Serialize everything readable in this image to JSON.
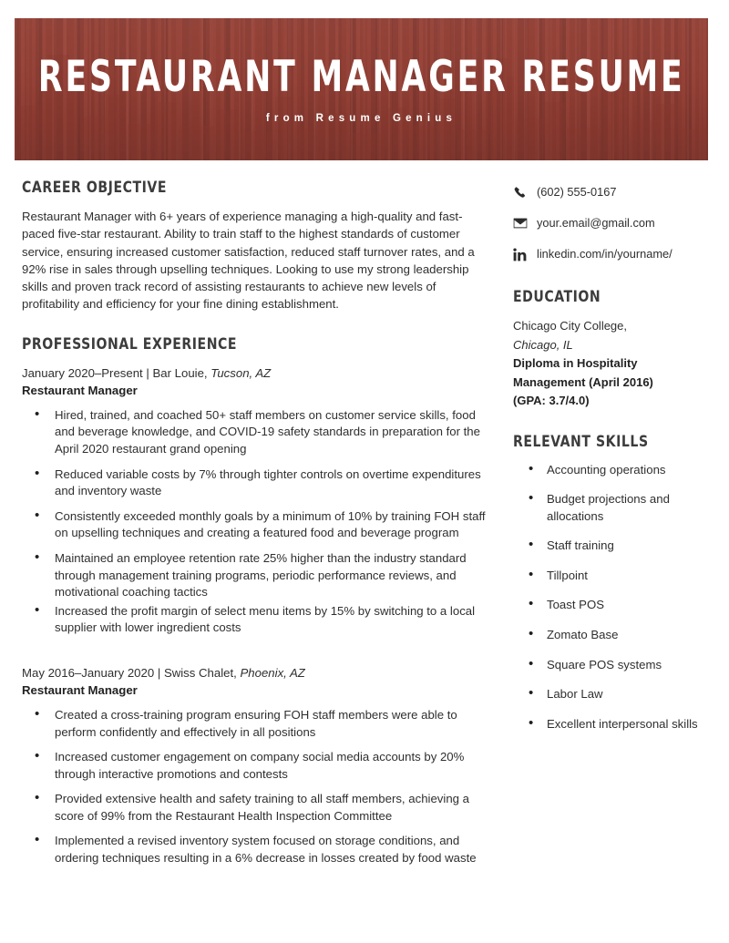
{
  "colors": {
    "banner_red": "#a54b3e",
    "heading_gray": "#3c3c3c",
    "body_text": "#2f2f2f"
  },
  "header": {
    "title": "RESTAURANT MANAGER RESUME",
    "subtitle": "from Resume Genius"
  },
  "left_column": {
    "objective": {
      "heading": "CAREER OBJECTIVE",
      "text": "Restaurant Manager with 6+ years of experience managing a high-quality and fast-paced five-star restaurant. Ability to train staff to the highest standards of customer service, ensuring increased customer satisfaction, reduced staff turnover rates, and a 92% rise in sales through upselling techniques. Looking to use my strong leadership skills and proven track record of assisting restaurants to achieve new levels of profitability and efficiency for your fine dining establishment."
    },
    "experience": {
      "heading": "PROFESSIONAL EXPERIENCE",
      "jobs": [
        {
          "dates": "January 2020–Present",
          "separator": " | ",
          "company": "Bar Louie,",
          "location": "Tucson, AZ",
          "role": "Restaurant Manager",
          "bullets": [
            "Hired, trained, and coached 50+ staff members on customer service skills, food and beverage knowledge, and COVID-19 safety standards in preparation for the April 2020 restaurant grand opening",
            "Reduced variable costs by 7% through tighter controls on overtime expenditures and inventory waste",
            "Consistently exceeded monthly goals by a minimum of 10% by training FOH staff on upselling techniques and creating a featured food and beverage program",
            "Maintained an employee retention rate 25% higher than the industry standard through management training programs, periodic performance reviews, and motivational coaching tactics",
            "Increased the profit margin of select menu items by 15% by switching to a local supplier with lower ingredient costs"
          ]
        },
        {
          "dates": "May 2016–January 2020",
          "separator": " | ",
          "company": "Swiss Chalet,",
          "location": "Phoenix, AZ",
          "role": "Restaurant Manager",
          "bullets": [
            "Created a cross-training program ensuring FOH staff members were able to perform confidently and effectively in all positions",
            "Increased customer engagement on company social media accounts by 20% through interactive promotions and contests",
            "Provided extensive health and safety training to all staff members, achieving a score of 99% from the Restaurant Health Inspection Committee",
            "Implemented a revised inventory system focused on storage conditions, and ordering techniques resulting in a 6% decrease in losses created by food waste"
          ]
        }
      ]
    }
  },
  "right_column": {
    "contact": [
      {
        "icon": "phone-icon",
        "value": "(602) 555-0167"
      },
      {
        "icon": "envelope-icon",
        "value": "your.email@gmail.com"
      },
      {
        "icon": "linkedin-icon",
        "value": "linkedin.com/in/yourname/"
      }
    ],
    "education": {
      "heading": "EDUCATION",
      "school": "Chicago City College,",
      "city": "Chicago, IL",
      "degree": "Diploma in Hospitality Management (April 2016)",
      "gpa": "(GPA: 3.7/4.0)"
    },
    "skills": {
      "heading": "RELEVANT SKILLS",
      "items": [
        "Accounting operations",
        "Budget projections and allocations",
        "Staff training",
        "Tillpoint",
        "Toast POS",
        "Zomato Base",
        "Square POS systems",
        "Labor Law",
        "Excellent interpersonal skills"
      ]
    }
  }
}
